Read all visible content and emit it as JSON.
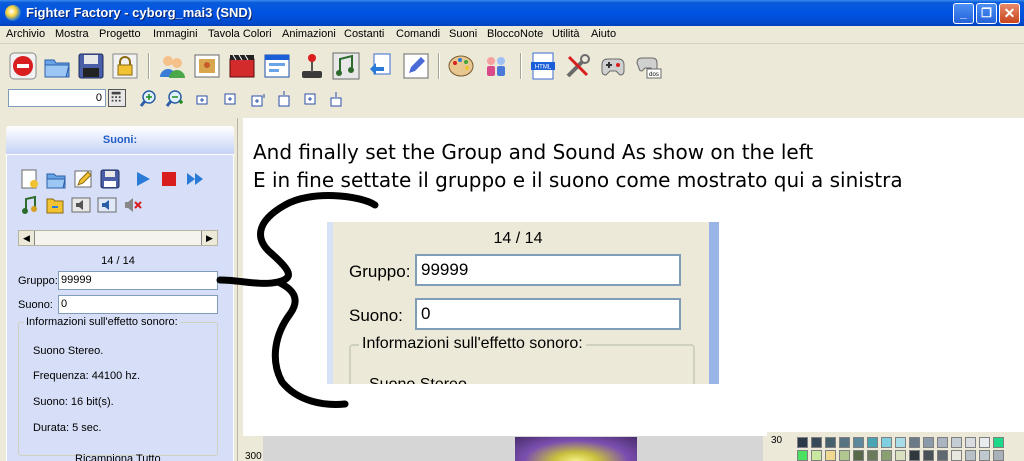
{
  "window": {
    "title": "Fighter Factory - cyborg_mai3 (SND)",
    "min_label": "_",
    "max_label": "❐",
    "close_label": "✕"
  },
  "menu": [
    "Archivio",
    "Mostra",
    "Progetto",
    "Immagini",
    "Tavola Colori",
    "Animazioni",
    "Costanti",
    "Comandi",
    "Suoni",
    "BloccoNote",
    "Utilità",
    "Aiuto"
  ],
  "toolbar": {
    "icons": [
      "stop-icon",
      "open-icon",
      "save-icon",
      "lock-icon",
      "users-icon",
      "image-icon",
      "film-icon",
      "window-icon",
      "joystick-icon",
      "sound-icon",
      "import-icon",
      "edit-icon",
      "palette-icon",
      "characters-icon",
      "html-icon",
      "tools-icon",
      "gamepad-icon",
      "dos-icon"
    ],
    "number_value": "0"
  },
  "panel": {
    "title": "Suoni:",
    "counter": "14 / 14",
    "group_label": "Gruppo:",
    "group_value": "99999",
    "sound_label": "Suono:",
    "sound_value": "0",
    "info_title": "Informazioni sull'effetto sonoro:",
    "info_lines": [
      "Suono Stereo.",
      "Frequenza: 44100 hz.",
      "Suono: 16 bit(s).",
      "Durata: 5 sec."
    ],
    "bottom_label": "Ricampiona Tutto"
  },
  "instructions": {
    "line1": "And finally set the Group and Sound As show on the left",
    "line2": "E in fine settate il gruppo e il suono come mostrato qui a sinistra"
  },
  "zoom": {
    "counter": "14 / 14",
    "group_label": "Gruppo:",
    "group_value": "99999",
    "sound_label": "Suono:",
    "sound_value": "0",
    "info_title": "Informazioni sull'effetto sonoro:",
    "clipped": "Suono Stereo"
  },
  "bottom": {
    "ruler_left": "300",
    "palette_label": "30"
  },
  "colors": {
    "titlebar": "#0054E3",
    "panel_header_text": "#215DC6"
  }
}
